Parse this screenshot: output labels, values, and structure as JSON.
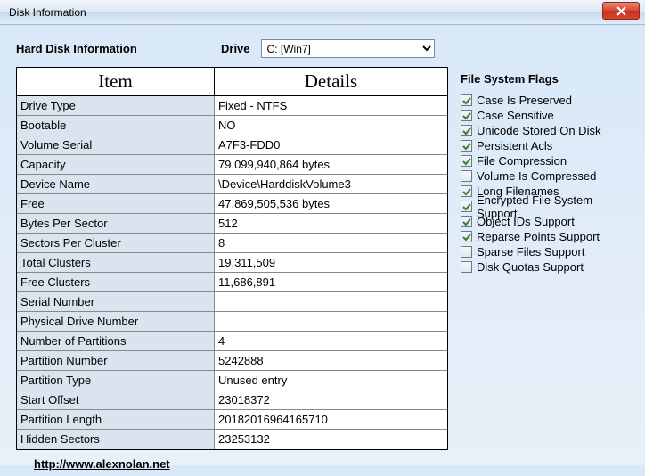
{
  "window": {
    "title": "Disk Information"
  },
  "header": {
    "label": "Hard Disk Information",
    "drive_label": "Drive",
    "drive_value": "C: [Win7]"
  },
  "table": {
    "col_item": "Item",
    "col_details": "Details",
    "rows": [
      {
        "item": "Drive Type",
        "details": "Fixed - NTFS"
      },
      {
        "item": "Bootable",
        "details": "NO"
      },
      {
        "item": "Volume Serial",
        "details": "A7F3-FDD0"
      },
      {
        "item": "Capacity",
        "details": "79,099,940,864 bytes"
      },
      {
        "item": "Device Name",
        "details": "\\Device\\HarddiskVolume3"
      },
      {
        "item": "Free",
        "details": "47,869,505,536 bytes"
      },
      {
        "item": "Bytes Per Sector",
        "details": "512"
      },
      {
        "item": "Sectors Per Cluster",
        "details": "8"
      },
      {
        "item": "Total Clusters",
        "details": "19,311,509"
      },
      {
        "item": "Free Clusters",
        "details": "11,686,891"
      },
      {
        "item": "Serial Number",
        "details": ""
      },
      {
        "item": "Physical Drive Number",
        "details": ""
      },
      {
        "item": "Number of Partitions",
        "details": "4"
      },
      {
        "item": "Partition Number",
        "details": "5242888"
      },
      {
        "item": "Partition Type",
        "details": "Unused entry"
      },
      {
        "item": "Start Offset",
        "details": "23018372"
      },
      {
        "item": "Partition Length",
        "details": "20182016964165710"
      },
      {
        "item": "Hidden Sectors",
        "details": "23253132"
      }
    ]
  },
  "flags": {
    "title": "File System Flags",
    "items": [
      {
        "label": "Case Is Preserved",
        "checked": true
      },
      {
        "label": "Case Sensitive",
        "checked": true
      },
      {
        "label": "Unicode Stored On Disk",
        "checked": true
      },
      {
        "label": "Persistent Acls",
        "checked": true
      },
      {
        "label": "File Compression",
        "checked": true
      },
      {
        "label": "Volume Is Compressed",
        "checked": false
      },
      {
        "label": "Long Filenames",
        "checked": true
      },
      {
        "label": "Encrypted File System Support",
        "checked": true
      },
      {
        "label": "Object IDs Support",
        "checked": true
      },
      {
        "label": "Reparse Points Support",
        "checked": true
      },
      {
        "label": "Sparse Files Support",
        "checked": false
      },
      {
        "label": "Disk Quotas Support",
        "checked": false
      }
    ]
  },
  "footer": {
    "link": "http://www.alexnolan.net"
  }
}
